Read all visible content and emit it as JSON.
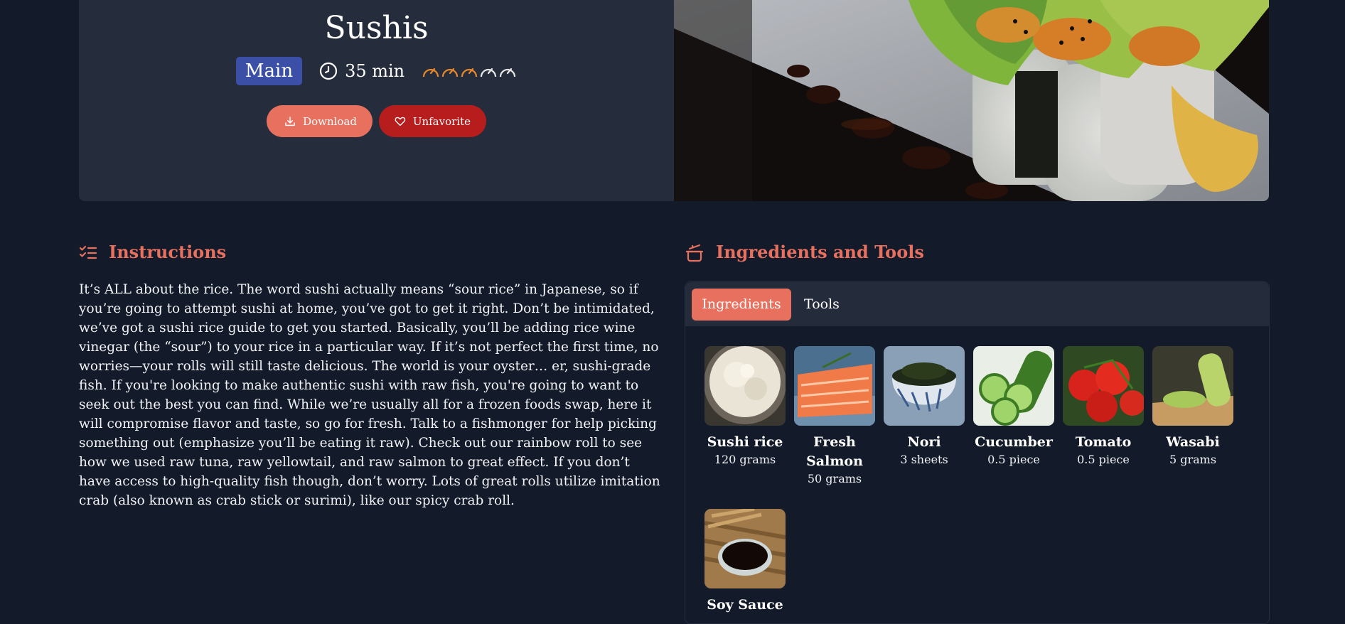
{
  "recipe": {
    "title": "Sushis",
    "category": "Main",
    "time": "35 min",
    "difficulty": {
      "level": 3,
      "max": 5
    },
    "download_label": "Download",
    "unfavorite_label": "Unfavorite"
  },
  "instructions": {
    "heading": "Instructions",
    "text": "It’s ALL about the rice. The word sushi actually means “sour rice” in Japanese, so if you’re going to attempt sushi at home, you’ve got to get it right. Don’t be intimidated, we’ve got a sushi rice guide to get you started. Basically, you’ll be adding rice wine vinegar (the “sour”) to your rice in a particular way. If it’s not perfect the first time, no worries—your rolls will still taste delicious. The world is your oyster… er, sushi-grade fish. If you're looking to make authentic sushi with raw fish, you're going to want to seek out the best you can find. While we’re usually all for a frozen foods swap, here it will compromise flavor and taste, so go for fresh. Talk to a fishmonger for help picking something out (emphasize you’ll be eating it raw). Check out our rainbow roll to see how we used raw tuna, raw yellowtail, and raw salmon to great effect. If you don’t have access to high-quality fish though, don’t worry. Lots of great rolls utilize imitation crab (also known as crab stick or surimi), like our spicy crab roll."
  },
  "ingredients_section": {
    "heading": "Ingredients and Tools",
    "tabs": [
      "Ingredients",
      "Tools"
    ],
    "items": [
      {
        "name": "Sushi rice",
        "qty": "120 grams"
      },
      {
        "name": "Fresh Salmon",
        "qty": "50 grams"
      },
      {
        "name": "Nori",
        "qty": "3 sheets"
      },
      {
        "name": "Cucumber",
        "qty": "0.5 piece"
      },
      {
        "name": "Tomato",
        "qty": "0.5 piece"
      },
      {
        "name": "Wasabi",
        "qty": "5 grams"
      },
      {
        "name": "Soy Sauce",
        "qty": ""
      }
    ]
  },
  "colors": {
    "accent": "#e8705e",
    "category": "#3b4fa6",
    "unfavorite": "#b81d1d",
    "background": "#131a2a"
  }
}
